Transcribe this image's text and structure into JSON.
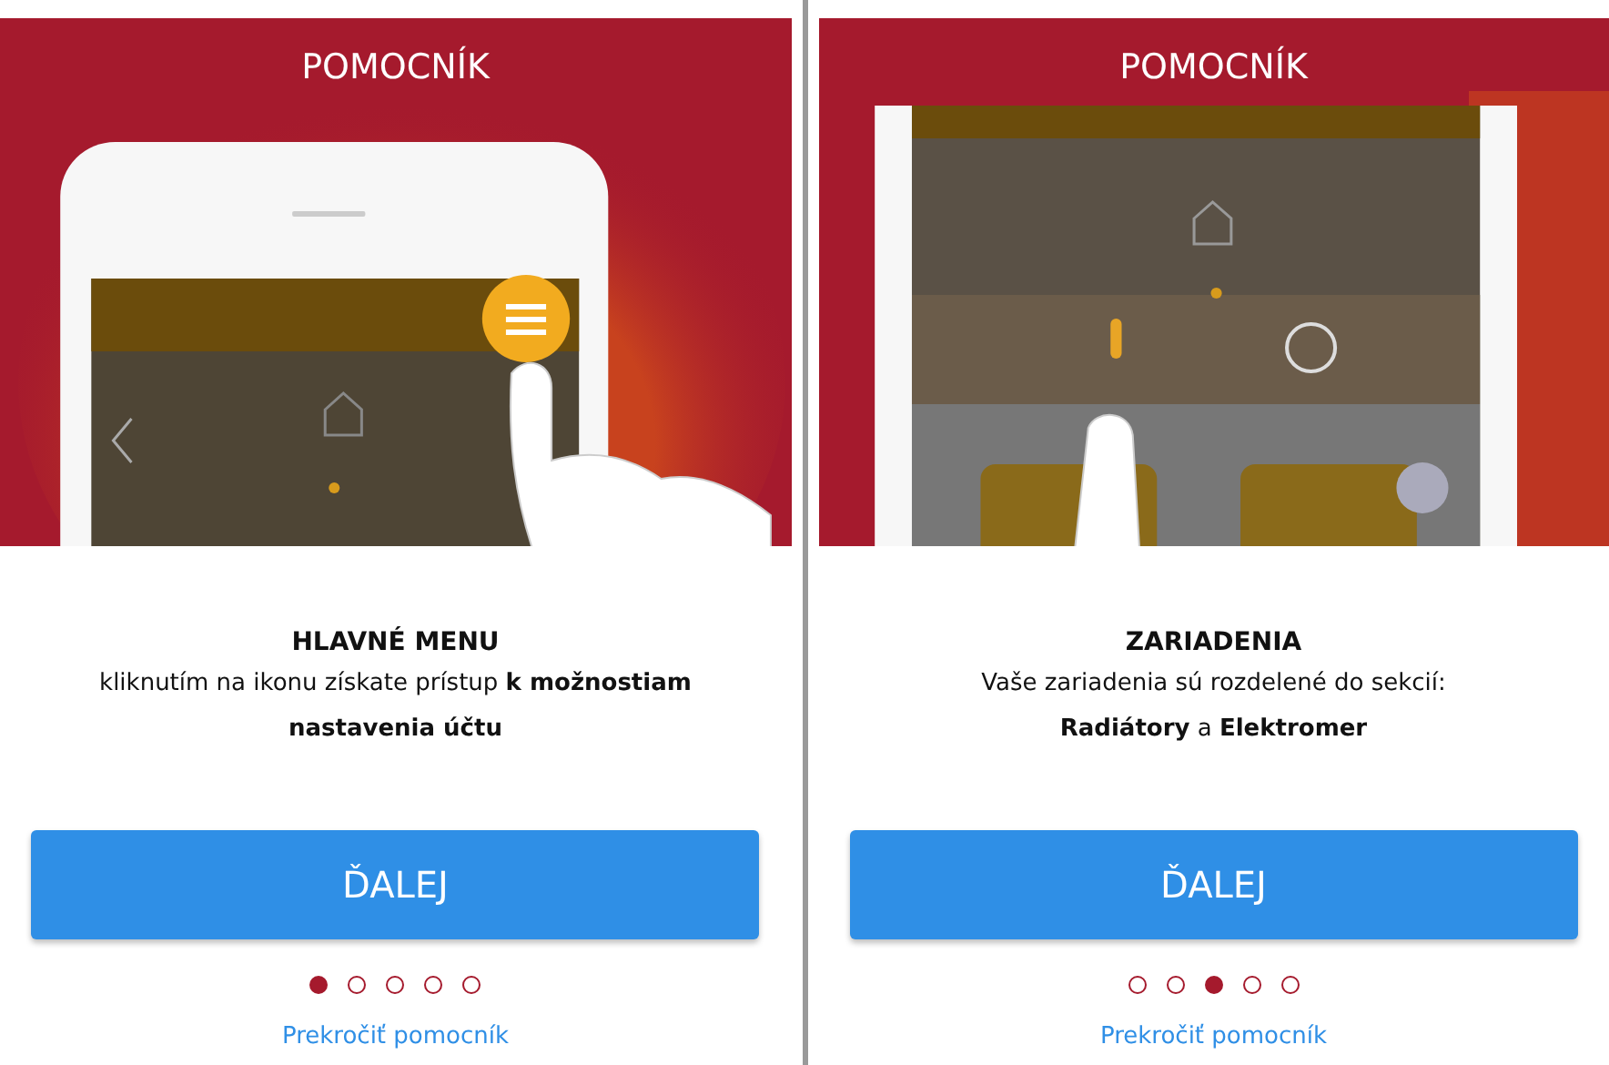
{
  "screens": [
    {
      "title": "POMOCNÍK",
      "kind": "menu",
      "heading": "HLAVNÉ MENU",
      "body": "kliknutím na ikonu získate prístup **k možnostiam**\n**nastavenia účtu**",
      "button": "ĎALEJ",
      "dots": [
        {
          "selected": true
        },
        {
          "selected": false
        },
        {
          "selected": false
        },
        {
          "selected": false
        },
        {
          "selected": false
        }
      ],
      "skip_link": "Prekročiť pomocník"
    },
    {
      "title": "POMOCNÍK",
      "kind": "devices",
      "heading": "ZARIADENIA",
      "body": "Vaše zariadenia sú rozdelené do sekcií:\n**Radiátory** a **Elektromer**",
      "button": "ĎALEJ",
      "dots": [
        {
          "selected": false
        },
        {
          "selected": false
        },
        {
          "selected": true
        },
        {
          "selected": false
        },
        {
          "selected": false
        }
      ],
      "skip_link": "Prekročiť pomocník"
    }
  ]
}
